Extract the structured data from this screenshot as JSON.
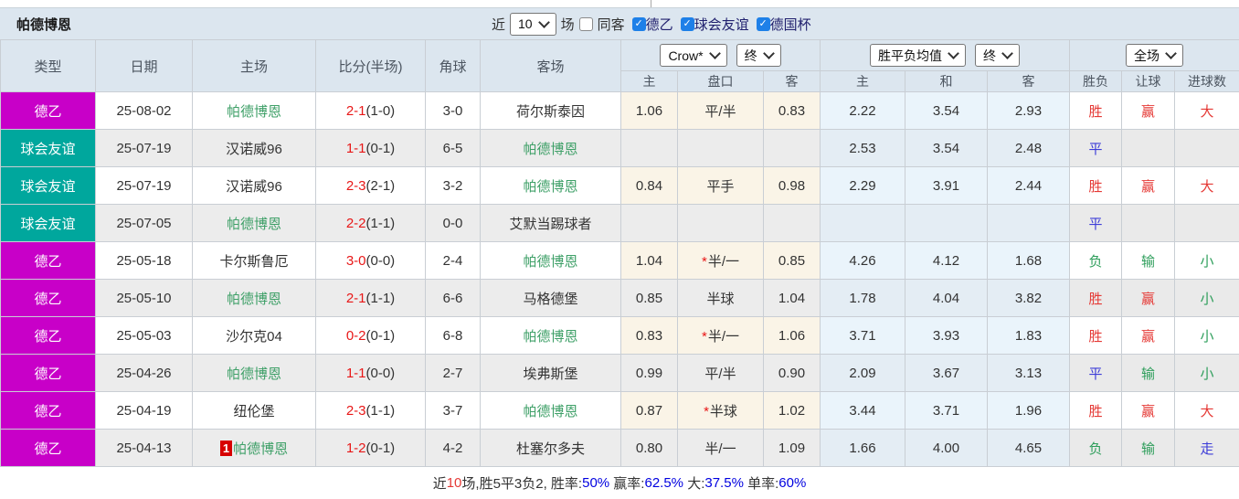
{
  "title": "帕德博恩",
  "filter_bar": {
    "recent_label": "近",
    "recent_value": "10",
    "matches_label": "场",
    "same_away": {
      "label": "同客",
      "checked": false
    },
    "leagues": [
      {
        "label": "德乙",
        "checked": true
      },
      {
        "label": "球会友谊",
        "checked": true
      },
      {
        "label": "德国杯",
        "checked": true
      }
    ]
  },
  "table": {
    "left_headers": [
      "类型",
      "日期",
      "主场",
      "比分(半场)",
      "角球",
      "客场"
    ],
    "selects": {
      "handicap_company": "Crow*",
      "handicap_time": "终",
      "odds_type": "胜平负均值",
      "odds_time": "终",
      "scope": "全场"
    },
    "sub_headers": [
      "主",
      "盘口",
      "客",
      "主",
      "和",
      "客",
      "胜负",
      "让球",
      "进球数"
    ],
    "rows": [
      {
        "type": "德乙",
        "date": "25-08-02",
        "home": "帕德博恩",
        "home_self": true,
        "home_badge": "",
        "score": "2-1",
        "half_score": "(1-0)",
        "corners": "3-0",
        "away": "荷尔斯泰因",
        "away_self": false,
        "ah_home": "1.06",
        "ah_star": false,
        "ah_line": "平/半",
        "ah_away": "0.83",
        "avg_home": "2.22",
        "avg_draw": "3.54",
        "avg_away": "2.93",
        "result": "胜",
        "handicap_result": "赢",
        "goals": "大"
      },
      {
        "type": "球会友谊",
        "date": "25-07-19",
        "home": "汉诺威96",
        "home_self": false,
        "home_badge": "",
        "score": "1-1",
        "half_score": "(0-1)",
        "corners": "6-5",
        "away": "帕德博恩",
        "away_self": true,
        "ah_home": "",
        "ah_star": false,
        "ah_line": "",
        "ah_away": "",
        "avg_home": "2.53",
        "avg_draw": "3.54",
        "avg_away": "2.48",
        "result": "平",
        "handicap_result": "",
        "goals": ""
      },
      {
        "type": "球会友谊",
        "date": "25-07-19",
        "home": "汉诺威96",
        "home_self": false,
        "home_badge": "",
        "score": "2-3",
        "half_score": "(2-1)",
        "corners": "3-2",
        "away": "帕德博恩",
        "away_self": true,
        "ah_home": "0.84",
        "ah_star": false,
        "ah_line": "平手",
        "ah_away": "0.98",
        "avg_home": "2.29",
        "avg_draw": "3.91",
        "avg_away": "2.44",
        "result": "胜",
        "handicap_result": "赢",
        "goals": "大"
      },
      {
        "type": "球会友谊",
        "date": "25-07-05",
        "home": "帕德博恩",
        "home_self": true,
        "home_badge": "",
        "score": "2-2",
        "half_score": "(1-1)",
        "corners": "0-0",
        "away": "艾默当踢球者",
        "away_self": false,
        "ah_home": "",
        "ah_star": false,
        "ah_line": "",
        "ah_away": "",
        "avg_home": "",
        "avg_draw": "",
        "avg_away": "",
        "result": "平",
        "handicap_result": "",
        "goals": ""
      },
      {
        "type": "德乙",
        "date": "25-05-18",
        "home": "卡尔斯鲁厄",
        "home_self": false,
        "home_badge": "",
        "score": "3-0",
        "half_score": "(0-0)",
        "corners": "2-4",
        "away": "帕德博恩",
        "away_self": true,
        "ah_home": "1.04",
        "ah_star": true,
        "ah_line": "半/一",
        "ah_away": "0.85",
        "avg_home": "4.26",
        "avg_draw": "4.12",
        "avg_away": "1.68",
        "result": "负",
        "handicap_result": "输",
        "goals": "小"
      },
      {
        "type": "德乙",
        "date": "25-05-10",
        "home": "帕德博恩",
        "home_self": true,
        "home_badge": "",
        "score": "2-1",
        "half_score": "(1-1)",
        "corners": "6-6",
        "away": "马格德堡",
        "away_self": false,
        "ah_home": "0.85",
        "ah_star": false,
        "ah_line": "半球",
        "ah_away": "1.04",
        "avg_home": "1.78",
        "avg_draw": "4.04",
        "avg_away": "3.82",
        "result": "胜",
        "handicap_result": "赢",
        "goals": "小"
      },
      {
        "type": "德乙",
        "date": "25-05-03",
        "home": "沙尔克04",
        "home_self": false,
        "home_badge": "",
        "score": "0-2",
        "half_score": "(0-1)",
        "corners": "6-8",
        "away": "帕德博恩",
        "away_self": true,
        "ah_home": "0.83",
        "ah_star": true,
        "ah_line": "半/一",
        "ah_away": "1.06",
        "avg_home": "3.71",
        "avg_draw": "3.93",
        "avg_away": "1.83",
        "result": "胜",
        "handicap_result": "赢",
        "goals": "小"
      },
      {
        "type": "德乙",
        "date": "25-04-26",
        "home": "帕德博恩",
        "home_self": true,
        "home_badge": "",
        "score": "1-1",
        "half_score": "(0-0)",
        "corners": "2-7",
        "away": "埃弗斯堡",
        "away_self": false,
        "ah_home": "0.99",
        "ah_star": false,
        "ah_line": "平/半",
        "ah_away": "0.90",
        "avg_home": "2.09",
        "avg_draw": "3.67",
        "avg_away": "3.13",
        "result": "平",
        "handicap_result": "输",
        "goals": "小"
      },
      {
        "type": "德乙",
        "date": "25-04-19",
        "home": "纽伦堡",
        "home_self": false,
        "home_badge": "",
        "score": "2-3",
        "half_score": "(1-1)",
        "corners": "3-7",
        "away": "帕德博恩",
        "away_self": true,
        "ah_home": "0.87",
        "ah_star": true,
        "ah_line": "半球",
        "ah_away": "1.02",
        "avg_home": "3.44",
        "avg_draw": "3.71",
        "avg_away": "1.96",
        "result": "胜",
        "handicap_result": "赢",
        "goals": "大"
      },
      {
        "type": "德乙",
        "date": "25-04-13",
        "home": "帕德博恩",
        "home_self": true,
        "home_badge": "1",
        "score": "1-2",
        "half_score": "(0-1)",
        "corners": "4-2",
        "away": "杜塞尔多夫",
        "away_self": false,
        "ah_home": "0.80",
        "ah_star": false,
        "ah_line": "半/一",
        "ah_away": "1.09",
        "avg_home": "1.66",
        "avg_draw": "4.00",
        "avg_away": "4.65",
        "result": "负",
        "handicap_result": "输",
        "goals": "走"
      }
    ]
  },
  "type_colors": {
    "德乙": "#c800c8",
    "球会友谊": "#00a79d"
  },
  "outcome_colors": {
    "胜": "#e53935",
    "平": "#3d3dd8",
    "负": "#2e9e5b",
    "赢": "#e53935",
    "输": "#2e9e5b",
    "大": "#e53935",
    "小": "#2e9e5b",
    "走": "#3d3dd8"
  },
  "colors": {
    "self_team": "#3fa068",
    "score_red": "#e81717",
    "rank_badge": "#d70000",
    "checkbox_blue": "#1e80e8",
    "league_de2": "#c800c8",
    "league_friendly": "#00a79d",
    "stat_blue": "#0000e0"
  },
  "footer_parts": [
    {
      "text": "近",
      "color": "#333333"
    },
    {
      "text": "10",
      "color": "#e53935"
    },
    {
      "text": "场,胜5平3负2, 胜率:",
      "color": "#333333"
    },
    {
      "text": "50%",
      "color": "#0000e0"
    },
    {
      "text": " 赢率:",
      "color": "#333333"
    },
    {
      "text": "62.5%",
      "color": "#0000e0"
    },
    {
      "text": " 大:",
      "color": "#333333"
    },
    {
      "text": "37.5%",
      "color": "#0000e0"
    },
    {
      "text": " 单率:",
      "color": "#333333"
    },
    {
      "text": "60%",
      "color": "#0000e0"
    }
  ]
}
